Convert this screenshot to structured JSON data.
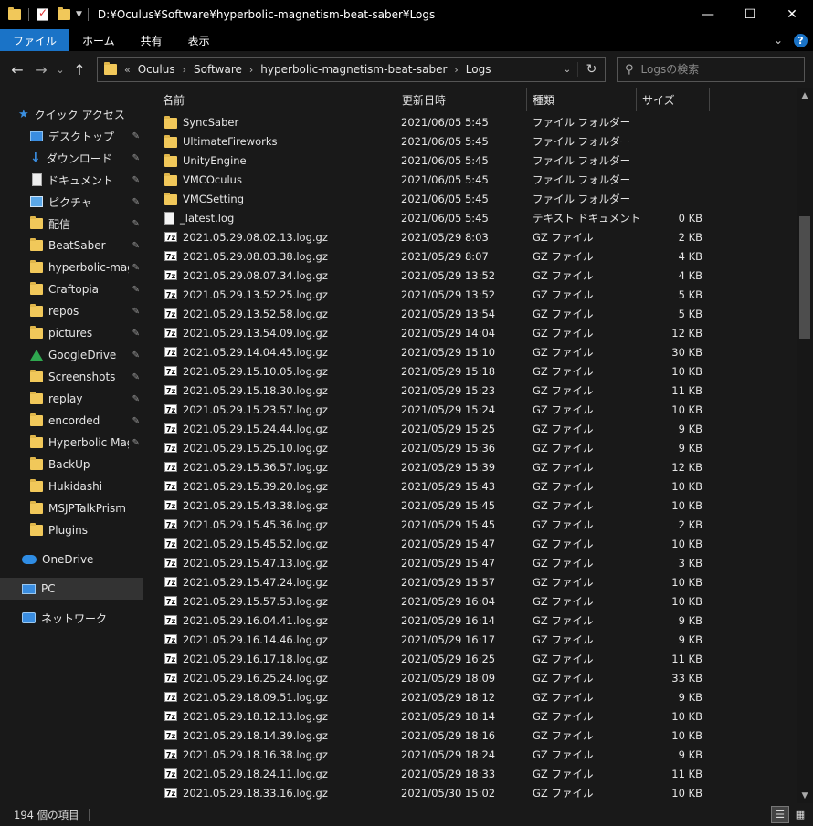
{
  "window": {
    "title_path": "D:¥Oculus¥Software¥hyperbolic-magnetism-beat-saber¥Logs",
    "min_glyph": "—",
    "max_glyph": "☐",
    "close_glyph": "✕"
  },
  "ribbon": {
    "tabs": [
      "ファイル",
      "ホーム",
      "共有",
      "表示"
    ],
    "expand_glyph": "⌄",
    "help_glyph": "?"
  },
  "nav": {
    "back": "←",
    "forward": "→",
    "history": "⌄",
    "up": "↑"
  },
  "address": {
    "overflow": "«",
    "crumbs": [
      "Oculus",
      "Software",
      "hyperbolic-magnetism-beat-saber",
      "Logs"
    ],
    "crumb_sep": "›",
    "dropdown": "⌄",
    "refresh": "↻"
  },
  "search": {
    "placeholder": "Logsの検索",
    "icon": "⚲"
  },
  "sidebar": {
    "items": [
      {
        "label": "クイック アクセス",
        "icon": "star-icon",
        "pinned": false
      },
      {
        "label": "デスクトップ",
        "icon": "desktop-icon",
        "pinned": true
      },
      {
        "label": "ダウンロード",
        "icon": "download-icon",
        "pinned": true
      },
      {
        "label": "ドキュメント",
        "icon": "document-icon",
        "pinned": true
      },
      {
        "label": "ピクチャ",
        "icon": "pictures-icon",
        "pinned": true
      },
      {
        "label": "配信",
        "icon": "folder-icon",
        "pinned": true
      },
      {
        "label": "BeatSaber",
        "icon": "folder-icon",
        "pinned": true
      },
      {
        "label": "hyperbolic-magr",
        "icon": "folder-icon",
        "pinned": true
      },
      {
        "label": "Craftopia",
        "icon": "folder-icon",
        "pinned": true
      },
      {
        "label": "repos",
        "icon": "folder-icon",
        "pinned": true
      },
      {
        "label": "pictures",
        "icon": "folder-icon",
        "pinned": true
      },
      {
        "label": "GoogleDrive",
        "icon": "google-drive-icon",
        "pinned": true
      },
      {
        "label": "Screenshots",
        "icon": "folder-icon",
        "pinned": true
      },
      {
        "label": "replay",
        "icon": "folder-icon",
        "pinned": true
      },
      {
        "label": "encorded",
        "icon": "folder-icon",
        "pinned": true
      },
      {
        "label": "Hyperbolic Magr",
        "icon": "folder-icon",
        "pinned": true
      },
      {
        "label": "BackUp",
        "icon": "folder-icon",
        "pinned": false
      },
      {
        "label": "Hukidashi",
        "icon": "folder-icon",
        "pinned": false
      },
      {
        "label": "MSJPTalkPrism",
        "icon": "folder-icon",
        "pinned": false
      },
      {
        "label": "Plugins",
        "icon": "folder-icon",
        "pinned": false
      },
      {
        "label": "OneDrive",
        "icon": "onedrive-icon",
        "pinned": false
      },
      {
        "label": "PC",
        "icon": "pc-icon",
        "pinned": false
      },
      {
        "label": "ネットワーク",
        "icon": "network-icon",
        "pinned": false
      }
    ],
    "pin_glyph": "📌"
  },
  "columns": {
    "name": "名前",
    "date": "更新日時",
    "type": "種類",
    "size": "サイズ",
    "sort_glyph": "^"
  },
  "files": [
    {
      "name": "SyncSaber",
      "date": "2021/06/05 5:45",
      "type": "ファイル フォルダー",
      "size": "",
      "kind": "folder"
    },
    {
      "name": "UltimateFireworks",
      "date": "2021/06/05 5:45",
      "type": "ファイル フォルダー",
      "size": "",
      "kind": "folder"
    },
    {
      "name": "UnityEngine",
      "date": "2021/06/05 5:45",
      "type": "ファイル フォルダー",
      "size": "",
      "kind": "folder"
    },
    {
      "name": "VMCOculus",
      "date": "2021/06/05 5:45",
      "type": "ファイル フォルダー",
      "size": "",
      "kind": "folder"
    },
    {
      "name": "VMCSetting",
      "date": "2021/06/05 5:45",
      "type": "ファイル フォルダー",
      "size": "",
      "kind": "folder"
    },
    {
      "name": "_latest.log",
      "date": "2021/06/05 5:45",
      "type": "テキスト ドキュメント",
      "size": "0 KB",
      "kind": "log"
    },
    {
      "name": "2021.05.29.08.02.13.log.gz",
      "date": "2021/05/29 8:03",
      "type": "GZ ファイル",
      "size": "2 KB",
      "kind": "gz"
    },
    {
      "name": "2021.05.29.08.03.38.log.gz",
      "date": "2021/05/29 8:07",
      "type": "GZ ファイル",
      "size": "4 KB",
      "kind": "gz"
    },
    {
      "name": "2021.05.29.08.07.34.log.gz",
      "date": "2021/05/29 13:52",
      "type": "GZ ファイル",
      "size": "4 KB",
      "kind": "gz"
    },
    {
      "name": "2021.05.29.13.52.25.log.gz",
      "date": "2021/05/29 13:52",
      "type": "GZ ファイル",
      "size": "5 KB",
      "kind": "gz"
    },
    {
      "name": "2021.05.29.13.52.58.log.gz",
      "date": "2021/05/29 13:54",
      "type": "GZ ファイル",
      "size": "5 KB",
      "kind": "gz"
    },
    {
      "name": "2021.05.29.13.54.09.log.gz",
      "date": "2021/05/29 14:04",
      "type": "GZ ファイル",
      "size": "12 KB",
      "kind": "gz"
    },
    {
      "name": "2021.05.29.14.04.45.log.gz",
      "date": "2021/05/29 15:10",
      "type": "GZ ファイル",
      "size": "30 KB",
      "kind": "gz"
    },
    {
      "name": "2021.05.29.15.10.05.log.gz",
      "date": "2021/05/29 15:18",
      "type": "GZ ファイル",
      "size": "10 KB",
      "kind": "gz"
    },
    {
      "name": "2021.05.29.15.18.30.log.gz",
      "date": "2021/05/29 15:23",
      "type": "GZ ファイル",
      "size": "11 KB",
      "kind": "gz"
    },
    {
      "name": "2021.05.29.15.23.57.log.gz",
      "date": "2021/05/29 15:24",
      "type": "GZ ファイル",
      "size": "10 KB",
      "kind": "gz"
    },
    {
      "name": "2021.05.29.15.24.44.log.gz",
      "date": "2021/05/29 15:25",
      "type": "GZ ファイル",
      "size": "9 KB",
      "kind": "gz"
    },
    {
      "name": "2021.05.29.15.25.10.log.gz",
      "date": "2021/05/29 15:36",
      "type": "GZ ファイル",
      "size": "9 KB",
      "kind": "gz"
    },
    {
      "name": "2021.05.29.15.36.57.log.gz",
      "date": "2021/05/29 15:39",
      "type": "GZ ファイル",
      "size": "12 KB",
      "kind": "gz"
    },
    {
      "name": "2021.05.29.15.39.20.log.gz",
      "date": "2021/05/29 15:43",
      "type": "GZ ファイル",
      "size": "10 KB",
      "kind": "gz"
    },
    {
      "name": "2021.05.29.15.43.38.log.gz",
      "date": "2021/05/29 15:45",
      "type": "GZ ファイル",
      "size": "10 KB",
      "kind": "gz"
    },
    {
      "name": "2021.05.29.15.45.36.log.gz",
      "date": "2021/05/29 15:45",
      "type": "GZ ファイル",
      "size": "2 KB",
      "kind": "gz"
    },
    {
      "name": "2021.05.29.15.45.52.log.gz",
      "date": "2021/05/29 15:47",
      "type": "GZ ファイル",
      "size": "10 KB",
      "kind": "gz"
    },
    {
      "name": "2021.05.29.15.47.13.log.gz",
      "date": "2021/05/29 15:47",
      "type": "GZ ファイル",
      "size": "3 KB",
      "kind": "gz"
    },
    {
      "name": "2021.05.29.15.47.24.log.gz",
      "date": "2021/05/29 15:57",
      "type": "GZ ファイル",
      "size": "10 KB",
      "kind": "gz"
    },
    {
      "name": "2021.05.29.15.57.53.log.gz",
      "date": "2021/05/29 16:04",
      "type": "GZ ファイル",
      "size": "10 KB",
      "kind": "gz"
    },
    {
      "name": "2021.05.29.16.04.41.log.gz",
      "date": "2021/05/29 16:14",
      "type": "GZ ファイル",
      "size": "9 KB",
      "kind": "gz"
    },
    {
      "name": "2021.05.29.16.14.46.log.gz",
      "date": "2021/05/29 16:17",
      "type": "GZ ファイル",
      "size": "9 KB",
      "kind": "gz"
    },
    {
      "name": "2021.05.29.16.17.18.log.gz",
      "date": "2021/05/29 16:25",
      "type": "GZ ファイル",
      "size": "11 KB",
      "kind": "gz"
    },
    {
      "name": "2021.05.29.16.25.24.log.gz",
      "date": "2021/05/29 18:09",
      "type": "GZ ファイル",
      "size": "33 KB",
      "kind": "gz"
    },
    {
      "name": "2021.05.29.18.09.51.log.gz",
      "date": "2021/05/29 18:12",
      "type": "GZ ファイル",
      "size": "9 KB",
      "kind": "gz"
    },
    {
      "name": "2021.05.29.18.12.13.log.gz",
      "date": "2021/05/29 18:14",
      "type": "GZ ファイル",
      "size": "10 KB",
      "kind": "gz"
    },
    {
      "name": "2021.05.29.18.14.39.log.gz",
      "date": "2021/05/29 18:16",
      "type": "GZ ファイル",
      "size": "10 KB",
      "kind": "gz"
    },
    {
      "name": "2021.05.29.18.16.38.log.gz",
      "date": "2021/05/29 18:24",
      "type": "GZ ファイル",
      "size": "9 KB",
      "kind": "gz"
    },
    {
      "name": "2021.05.29.18.24.11.log.gz",
      "date": "2021/05/29 18:33",
      "type": "GZ ファイル",
      "size": "11 KB",
      "kind": "gz"
    },
    {
      "name": "2021.05.29.18.33.16.log.gz",
      "date": "2021/05/30 15:02",
      "type": "GZ ファイル",
      "size": "10 KB",
      "kind": "gz"
    }
  ],
  "gz_badge": "7z",
  "scrollbar": {
    "up": "▲",
    "down": "▼"
  },
  "status": {
    "item_count": "194 個の項目",
    "details_view_glyph": "☰",
    "icons_view_glyph": "▦"
  },
  "colors": {
    "accent": "#1a73c7",
    "background": "#191919",
    "folder": "#f1c85a"
  }
}
